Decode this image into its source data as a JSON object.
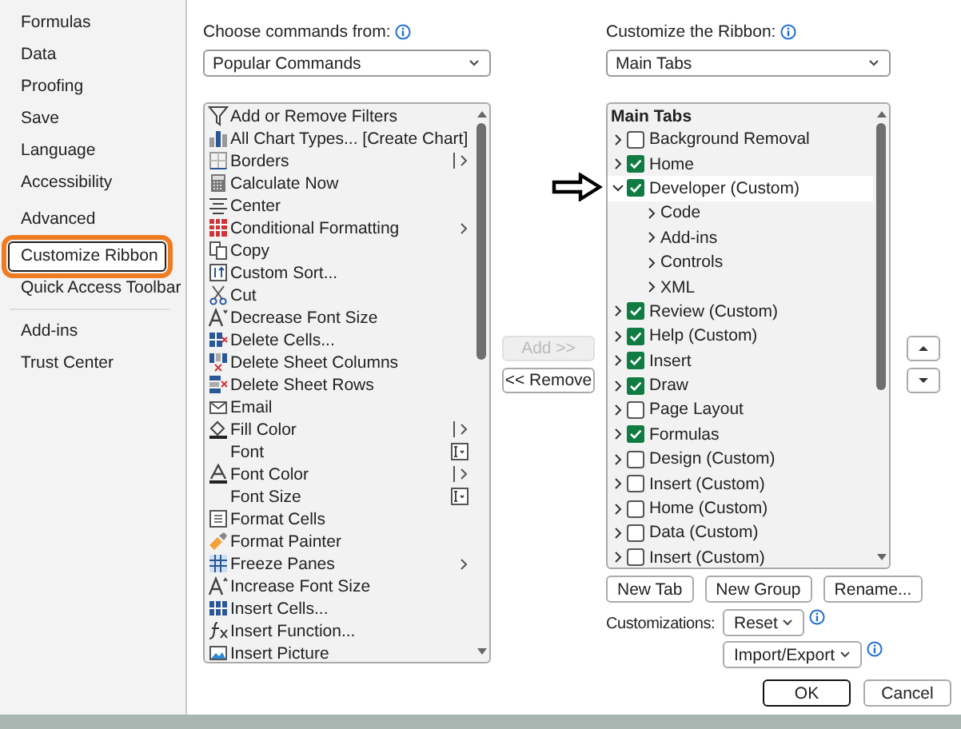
{
  "sidebar": {
    "items": [
      {
        "label": "Formulas",
        "selected": false
      },
      {
        "label": "Data",
        "selected": false
      },
      {
        "label": "Proofing",
        "selected": false
      },
      {
        "label": "Save",
        "selected": false
      },
      {
        "label": "Language",
        "selected": false
      },
      {
        "label": "Accessibility",
        "selected": false
      },
      {
        "label": "Advanced",
        "selected": false,
        "gap": true
      },
      {
        "label": "Customize Ribbon",
        "selected": true
      },
      {
        "label": "Quick Access Toolbar",
        "selected": false,
        "divider_after": true
      },
      {
        "label": "Add-ins",
        "selected": false
      },
      {
        "label": "Trust Center",
        "selected": false
      }
    ]
  },
  "commands": {
    "label": "Choose commands from:",
    "dropdown": "Popular Commands",
    "items": [
      {
        "label": "Add or Remove Filters",
        "kind": "plain"
      },
      {
        "label": "All Chart Types... [Create Chart]",
        "kind": "plain"
      },
      {
        "label": "Borders",
        "kind": "split"
      },
      {
        "label": "Calculate Now",
        "kind": "plain"
      },
      {
        "label": "Center",
        "kind": "plain"
      },
      {
        "label": "Conditional Formatting",
        "kind": "submenu"
      },
      {
        "label": "Copy",
        "kind": "plain"
      },
      {
        "label": "Custom Sort...",
        "kind": "plain"
      },
      {
        "label": "Cut",
        "kind": "plain"
      },
      {
        "label": "Decrease Font Size",
        "kind": "plain"
      },
      {
        "label": "Delete Cells...",
        "kind": "plain"
      },
      {
        "label": "Delete Sheet Columns",
        "kind": "plain"
      },
      {
        "label": "Delete Sheet Rows",
        "kind": "plain"
      },
      {
        "label": "Email",
        "kind": "plain"
      },
      {
        "label": "Fill Color",
        "kind": "split"
      },
      {
        "label": "Font",
        "kind": "field"
      },
      {
        "label": "Font Color",
        "kind": "split"
      },
      {
        "label": "Font Size",
        "kind": "field"
      },
      {
        "label": "Format Cells",
        "kind": "plain"
      },
      {
        "label": "Format Painter",
        "kind": "plain"
      },
      {
        "label": "Freeze Panes",
        "kind": "submenu"
      },
      {
        "label": "Increase Font Size",
        "kind": "plain"
      },
      {
        "label": "Insert Cells...",
        "kind": "plain"
      },
      {
        "label": "Insert Function...",
        "kind": "plain"
      },
      {
        "label": "Insert Picture",
        "kind": "plain"
      }
    ]
  },
  "add_button": {
    "label": "Add >>",
    "disabled": true
  },
  "remove_button": {
    "label": "<< Remove",
    "disabled": false
  },
  "ribbon": {
    "label": "Customize the Ribbon:",
    "dropdown": "Main Tabs",
    "tree_header": "Main Tabs",
    "tree": [
      {
        "label": "Background Removal",
        "checked": false,
        "expanded": false,
        "selected": false
      },
      {
        "label": "Home",
        "checked": true,
        "expanded": false,
        "selected": false
      },
      {
        "label": "Developer (Custom)",
        "checked": true,
        "expanded": true,
        "selected": true,
        "children": [
          {
            "label": "Code",
            "expanded": false,
            "selected": false
          },
          {
            "label": "Add-ins",
            "expanded": false,
            "selected": false
          },
          {
            "label": "Controls",
            "expanded": false,
            "selected": false
          },
          {
            "label": "XML",
            "expanded": false,
            "selected": false
          }
        ]
      },
      {
        "label": "Review (Custom)",
        "checked": true,
        "expanded": false,
        "selected": false
      },
      {
        "label": "Help (Custom)",
        "checked": true,
        "expanded": false,
        "selected": false
      },
      {
        "label": "Insert",
        "checked": true,
        "expanded": false,
        "selected": false
      },
      {
        "label": "Draw",
        "checked": true,
        "expanded": false,
        "selected": false
      },
      {
        "label": "Page Layout",
        "checked": false,
        "expanded": false,
        "selected": false
      },
      {
        "label": "Formulas",
        "checked": true,
        "expanded": false,
        "selected": false
      },
      {
        "label": "Design (Custom)",
        "checked": false,
        "expanded": false,
        "selected": false
      },
      {
        "label": "Insert (Custom)",
        "checked": false,
        "expanded": false,
        "selected": false
      },
      {
        "label": "Home (Custom)",
        "checked": false,
        "expanded": false,
        "selected": false
      },
      {
        "label": "Data (Custom)",
        "checked": false,
        "expanded": false,
        "selected": false
      },
      {
        "label": "Insert (Custom)",
        "checked": false,
        "expanded": false,
        "selected": false
      }
    ]
  },
  "tab_buttons": [
    "New Tab",
    "New Group",
    "Rename..."
  ],
  "customizations": {
    "label": "Customizations:",
    "reset": "Reset",
    "import_export": "Import/Export"
  },
  "footer": {
    "ok": "OK",
    "cancel": "Cancel"
  }
}
